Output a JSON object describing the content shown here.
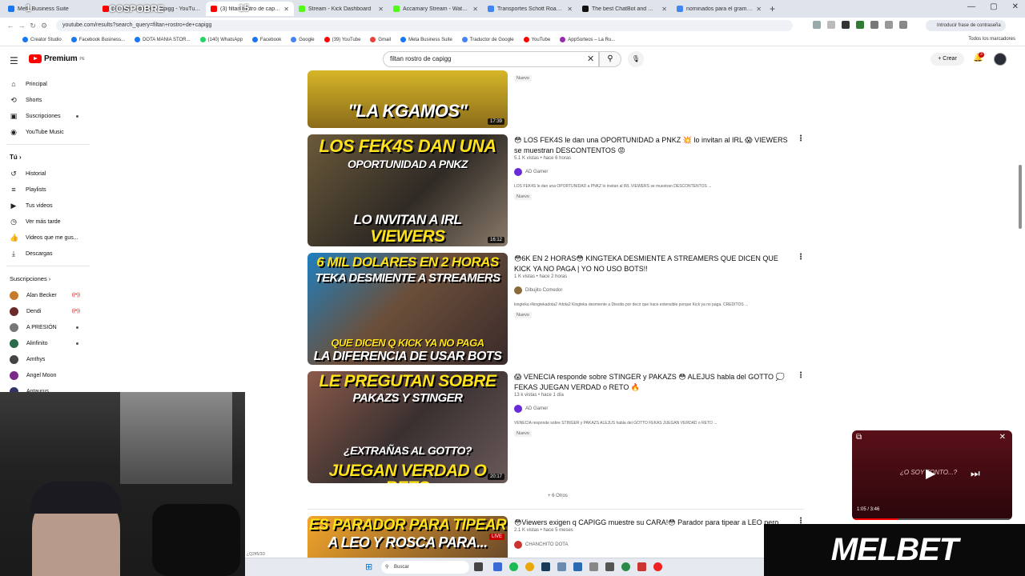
{
  "browser": {
    "tabs": [
      {
        "title": "Meta Business Suite",
        "color": "#1877f2"
      },
      {
        "title": "(3) filtan rostro de capigg - YouTube",
        "color": "#ff0000",
        "active": true
      },
      {
        "title": "Stream - Kick Dashboard",
        "color": "#53fc18"
      },
      {
        "title": "Accamary Stream - Watch Live",
        "color": "#53fc18"
      },
      {
        "title": "Transportes Schott RoadWays",
        "color": "#4285f4"
      },
      {
        "title": "The best ChatBot and Widgets",
        "color": "#111111"
      },
      {
        "title": "nominados para el grammy 20",
        "color": "#4285f4"
      }
    ],
    "overlay_labels": {
      "left_number": "1",
      "center_text": "COSPOBRE",
      "right_number": "15"
    },
    "url": "youtube.com/results?search_query=filtan+rostro+de+capigg",
    "password_prompt": "Introducir frase de contraseña",
    "bookmarks": [
      "Creator Studio",
      "Facebook Business...",
      "DOTA MANIA STOR...",
      "(140) WhatsApp",
      "Facebook",
      "Google",
      "(39) YouTube",
      "Gmail",
      "Meta Business Suite",
      "Traductor de Google",
      "YouTube",
      "AppSorteos – La Ru..."
    ],
    "all_bookmarks": "Todos los marcadores"
  },
  "youtube": {
    "logo": "Premium",
    "logo_region": "PE",
    "search_query": "filtan rostro de capigg",
    "create_label": "Crear",
    "notification_count": "3",
    "sidebar": {
      "main": [
        "Principal",
        "Shorts",
        "Suscripciones",
        "YouTube Music"
      ],
      "you_title": "Tú",
      "you": [
        "Historial",
        "Playlists",
        "Tus videos",
        "Ver más tarde",
        "Videos que me gus...",
        "Descargas"
      ],
      "subs_title": "Suscripciones",
      "subs": [
        {
          "name": "Alan Becker",
          "color": "#c77a2b"
        },
        {
          "name": "Dendi",
          "color": "#6b2a2a"
        },
        {
          "name": "A PRESIÓN",
          "color": "#777777"
        },
        {
          "name": "Alinfinito",
          "color": "#2a6b4a"
        },
        {
          "name": "Amthys",
          "color": "#444444"
        },
        {
          "name": "Angel Moon",
          "color": "#7a2b8a"
        },
        {
          "name": "Antaurus",
          "color": "#333366"
        }
      ]
    },
    "results": [
      {
        "thumb_lines": [
          "\"LA KGAMOS\""
        ],
        "duration": "17:39",
        "badge": "Nuevo"
      },
      {
        "thumb_lines": [
          "LOS FEK4S DAN UNA",
          "OPORTUNIDAD A PNKZ",
          "LO INVITAN A IRL",
          "VIEWERS DESCONTENTOS"
        ],
        "duration": "16:12",
        "title": "😳 LOS FEK4S le dan una OPORTUNIDAD a PNKZ 💥 lo invitan al IRL 😱 VIEWERS se muestran DESCONTENTOS 😡",
        "meta": "5.1 K vistas • hace 6 horas",
        "channel": "AD Gamer",
        "desc": "LOS FEK4S le dan una OPORTUNIDAD a PNKZ lo invitan al IRL VIEWERS se muestran DESCONTENTOS ...",
        "badge": "Nuevo"
      },
      {
        "thumb_lines": [
          "6 MIL DOLARES EN 2 HORAS",
          "TEKA DESMIENTE A STREAMERS",
          "QUE DICEN Q KICK YA NO PAGA",
          "LA DIFERENCIA DE USAR BOTS"
        ],
        "duration": "",
        "title": "😳6K EN 2 HORAS😳 KINGTEKA DESMIENTE A STREAMERS QUE DICEN QUE KICK YA NO PAGA | YO NO USO BOTS!!",
        "meta": "1 K vistas • hace 2 horas",
        "channel": "Dibujito Comedor",
        "desc": "kingteka #kingtekadota2 #dota2 Kingteka desmiente a Diesitis por decir que hace extensible porque Kick ya no paga. CREDITOS ...",
        "badge": "Nuevo"
      },
      {
        "thumb_lines": [
          "LE PREGUTAN SOBRE",
          "PAKAZS Y STINGER",
          "¿EXTRAÑAS AL GOTTO?",
          "JUEGAN VERDAD O RETO"
        ],
        "duration": "20:17",
        "title": "😱 VENECIA responde sobre STINGER y PAKAZS 😳 ALEJUS habla del GOTTO 💭 FEKAS JUEGAN VERDAD o RETO 🔥",
        "meta": "13 k vistas • hace 1 día",
        "channel": "AD Gamer",
        "desc": "VENECIA responde sobre STINGER y PAKAZS ALEJUS habla del GOTTO FEKAS JUEGAN VERDAD o RETO ...",
        "badge": "Nuevo"
      },
      {
        "thumb_lines": [
          "ES PARADOR PARA TIPEAR",
          "A LEO Y ROSCA PARA..."
        ],
        "duration": "LIVE",
        "title": "😳Viewers exigen q CAPIGG muestre su CARA!😳 Parador para tipear a LEO pero...",
        "meta": "2.1 K vistas • hace 5 meses",
        "channel": "CHANCHITO DOTA",
        "desc": "",
        "badge": ""
      }
    ],
    "more_label": "+ 6 Otros"
  },
  "miniplayer": {
    "time": "1:05 / 3:46",
    "overlay_text": "¿O SOY TONTO...?"
  },
  "ad": {
    "text": "MELBET"
  },
  "taskbar": {
    "search": "Buscar",
    "corner_label": "¿Q2¥5/3D"
  }
}
